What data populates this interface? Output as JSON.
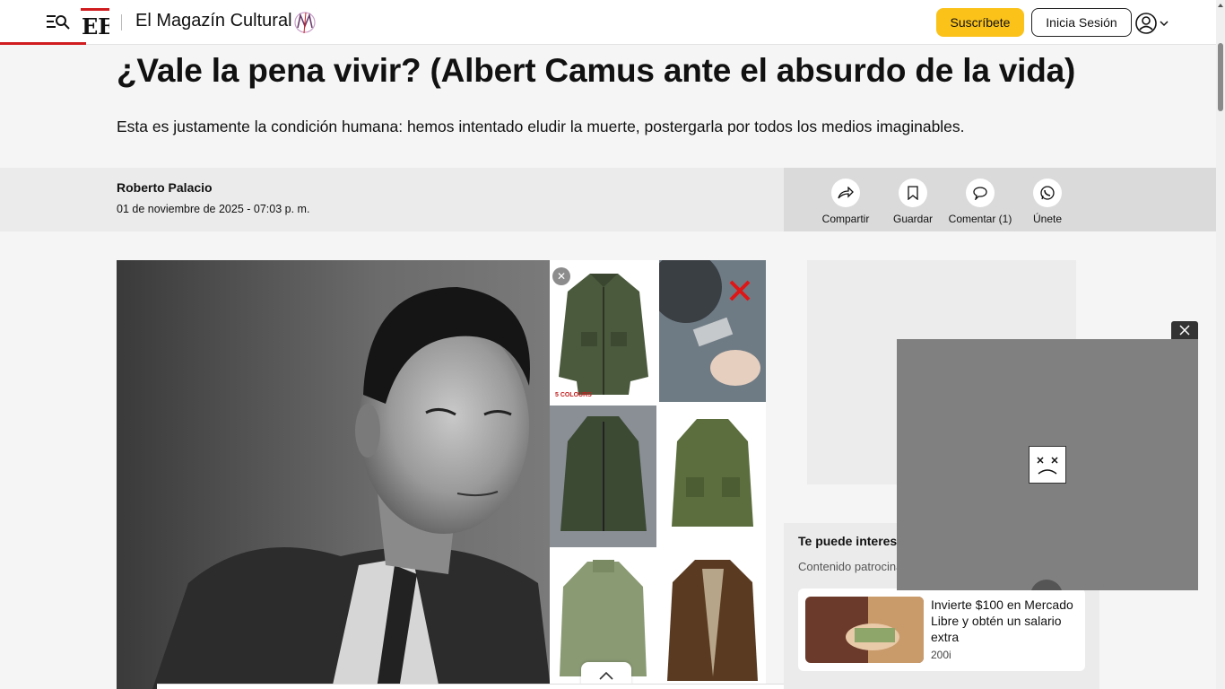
{
  "header": {
    "logo": "EE",
    "section_title": "El Magazín Cultural",
    "subscribe_label": "Suscríbete",
    "login_label": "Inicia Sesión",
    "accent_red": "#d01c1f",
    "accent_yellow": "#fbc21a"
  },
  "article": {
    "headline": "¿Vale la pena vivir? (Albert Camus ante el absurdo de la vida)",
    "lead": "Esta es justamente la condición humana: hemos intentado eludir la muerte, postergarla por todos los medios imaginables.",
    "author": "Roberto Palacio",
    "date": "01 de noviembre de 2025 - 07:03 p. m."
  },
  "actions": [
    {
      "label": "Compartir",
      "icon": "share-icon"
    },
    {
      "label": "Guardar",
      "icon": "bookmark-icon"
    },
    {
      "label": "Comentar (1)",
      "icon": "comment-icon"
    },
    {
      "label": "Únete",
      "icon": "whatsapp-icon"
    }
  ],
  "ad_grid": {
    "colours_label": "5 COLOURS"
  },
  "sidebar": {
    "interest_title": "Te puede interesar",
    "sponsored_label": "Contenido patrocinado",
    "card": {
      "title": "Invierte $100 en Mercado Libre y obtén un salario extra",
      "source": "200i"
    }
  }
}
